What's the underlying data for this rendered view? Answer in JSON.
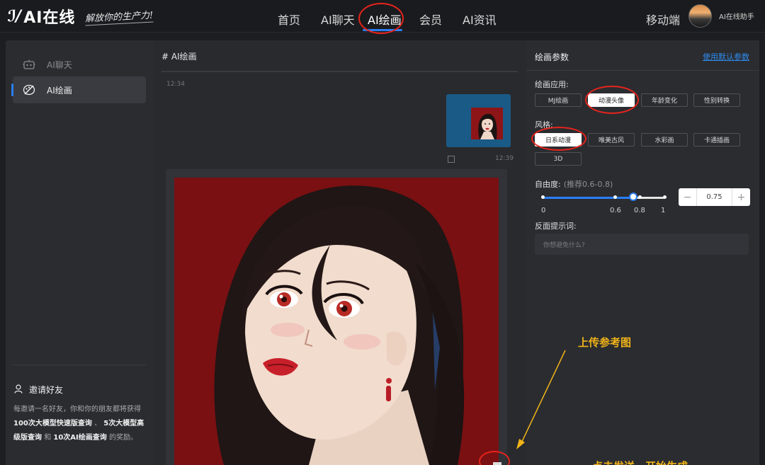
{
  "brand": {
    "logo": "AI在线",
    "slogan": "解放你的生产力!"
  },
  "nav": {
    "items": [
      {
        "label": "首页"
      },
      {
        "label": "AI聊天"
      },
      {
        "label": "AI绘画"
      },
      {
        "label": "会员"
      },
      {
        "label": "AI资讯"
      }
    ],
    "mobile": "移动端",
    "user_name": "AI在线助手"
  },
  "sidebar": {
    "items": [
      {
        "label": "AI聊天"
      },
      {
        "label": "AI绘画"
      }
    ],
    "invite_title": "邀请好友",
    "invite": {
      "p1": "每邀请一名好友，你和你的朋友都将获得",
      "b1": "100次大模型快速版查询",
      "p2": "、",
      "b2": "5次大模型高级版查询",
      "p3": "和",
      "b3": "10次AI绘画查询",
      "p4": "的奖励。"
    }
  },
  "chat": {
    "title": "# AI绘画",
    "time_sent": "12:34",
    "time_reply": "12:39"
  },
  "params": {
    "title": "绘画参数",
    "use_default": "使用默认参数",
    "app_label": "绘画应用:",
    "apps": [
      "MJ绘画",
      "动漫头像",
      "年龄变化",
      "性别转换"
    ],
    "app_selected": "动漫头像",
    "style_label": "风格:",
    "styles": [
      "日系动漫",
      "唯美古风",
      "水彩画",
      "卡通插画",
      "3D"
    ],
    "style_selected": "日系动漫",
    "freedom_label": "自由度:",
    "freedom_hint": "(推荐0.6-0.8)",
    "freedom_value": "0.75",
    "freedom_fraction": 0.75,
    "ticks": [
      "0",
      "0.6",
      "0.8",
      "1"
    ],
    "minus": "−",
    "plus": "+",
    "negative_label": "反面提示词:",
    "negative_placeholder": "你想避免什么?"
  },
  "annotations": {
    "upload": "上传参考图",
    "send": "点击发送，开始生成"
  },
  "colors": {
    "accent": "#2a7ef5",
    "annotation": "#f0b419",
    "highlight_circle": "#e6241c"
  }
}
